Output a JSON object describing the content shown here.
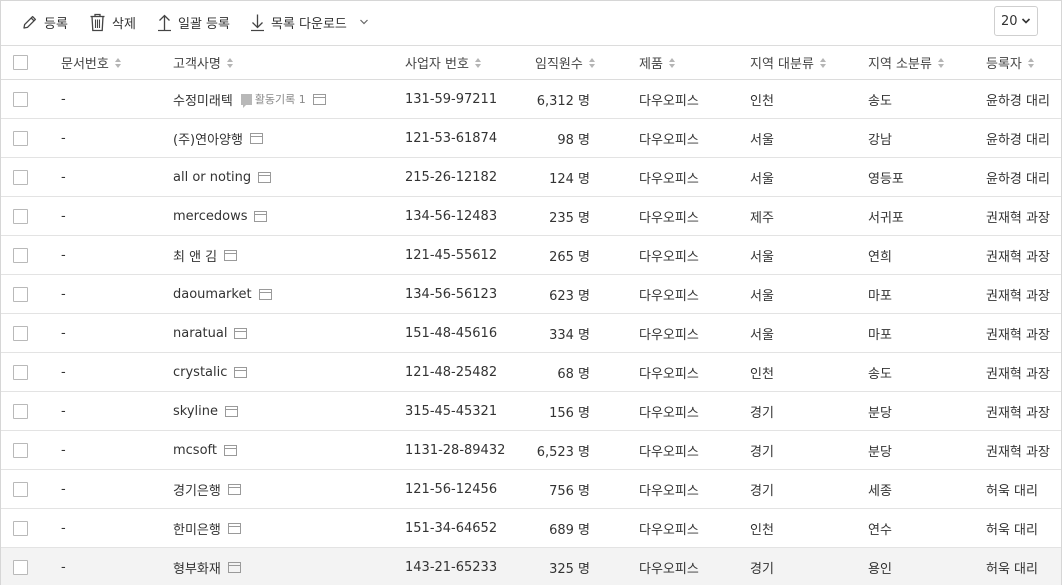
{
  "toolbar": {
    "register_label": "등록",
    "delete_label": "삭제",
    "bulk_label": "일괄 등록",
    "download_label": "목록 다운로드",
    "page_size": "20"
  },
  "columns": {
    "doc_no": "문서번호",
    "customer": "고객사명",
    "biz_no": "사업자 번호",
    "employees": "임직원수",
    "product": "제품",
    "region_major": "지역 대분류",
    "region_minor": "지역 소분류",
    "registrant": "등록자"
  },
  "rows": [
    {
      "doc": "-",
      "name": "수정미래텍",
      "activity": "활동기록 1",
      "biz": "131-59-97211",
      "emp": "6,312 명",
      "product": "다우오피스",
      "r1": "인천",
      "r2": "송도",
      "user": "윤하경 대리"
    },
    {
      "doc": "-",
      "name": "(주)연아양행",
      "biz": "121-53-61874",
      "emp": "98 명",
      "product": "다우오피스",
      "r1": "서울",
      "r2": "강남",
      "user": "윤하경 대리"
    },
    {
      "doc": "-",
      "name": "all or noting",
      "biz": "215-26-12182",
      "emp": "124 명",
      "product": "다우오피스",
      "r1": "서울",
      "r2": "영등포",
      "user": "윤하경 대리"
    },
    {
      "doc": "-",
      "name": "mercedows",
      "biz": "134-56-12483",
      "emp": "235 명",
      "product": "다우오피스",
      "r1": "제주",
      "r2": "서귀포",
      "user": "권재혁 과장"
    },
    {
      "doc": "-",
      "name": "최 앤 김",
      "biz": "121-45-55612",
      "emp": "265 명",
      "product": "다우오피스",
      "r1": "서울",
      "r2": "연희",
      "user": "권재혁 과장"
    },
    {
      "doc": "-",
      "name": "daoumarket",
      "biz": "134-56-56123",
      "emp": "623 명",
      "product": "다우오피스",
      "r1": "서울",
      "r2": "마포",
      "user": "권재혁 과장"
    },
    {
      "doc": "-",
      "name": "naratual",
      "biz": "151-48-45616",
      "emp": "334 명",
      "product": "다우오피스",
      "r1": "서울",
      "r2": "마포",
      "user": "권재혁 과장"
    },
    {
      "doc": "-",
      "name": "crystalic",
      "biz": "121-48-25482",
      "emp": "68 명",
      "product": "다우오피스",
      "r1": "인천",
      "r2": "송도",
      "user": "권재혁 과장"
    },
    {
      "doc": "-",
      "name": "skyline",
      "biz": "315-45-45321",
      "emp": "156 명",
      "product": "다우오피스",
      "r1": "경기",
      "r2": "분당",
      "user": "권재혁 과장"
    },
    {
      "doc": "-",
      "name": "mcsoft",
      "biz": "1131-28-89432",
      "emp": "6,523 명",
      "product": "다우오피스",
      "r1": "경기",
      "r2": "분당",
      "user": "권재혁 과장"
    },
    {
      "doc": "-",
      "name": "경기은행",
      "biz": "121-56-12456",
      "emp": "756 명",
      "product": "다우오피스",
      "r1": "경기",
      "r2": "세종",
      "user": "허욱 대리"
    },
    {
      "doc": "-",
      "name": "한미은행",
      "biz": "151-34-64652",
      "emp": "689 명",
      "product": "다우오피스",
      "r1": "인천",
      "r2": "연수",
      "user": "허욱 대리"
    },
    {
      "doc": "-",
      "name": "형부화재",
      "biz": "143-21-65233",
      "emp": "325 명",
      "product": "다우오피스",
      "r1": "경기",
      "r2": "용인",
      "user": "허욱 대리"
    }
  ]
}
